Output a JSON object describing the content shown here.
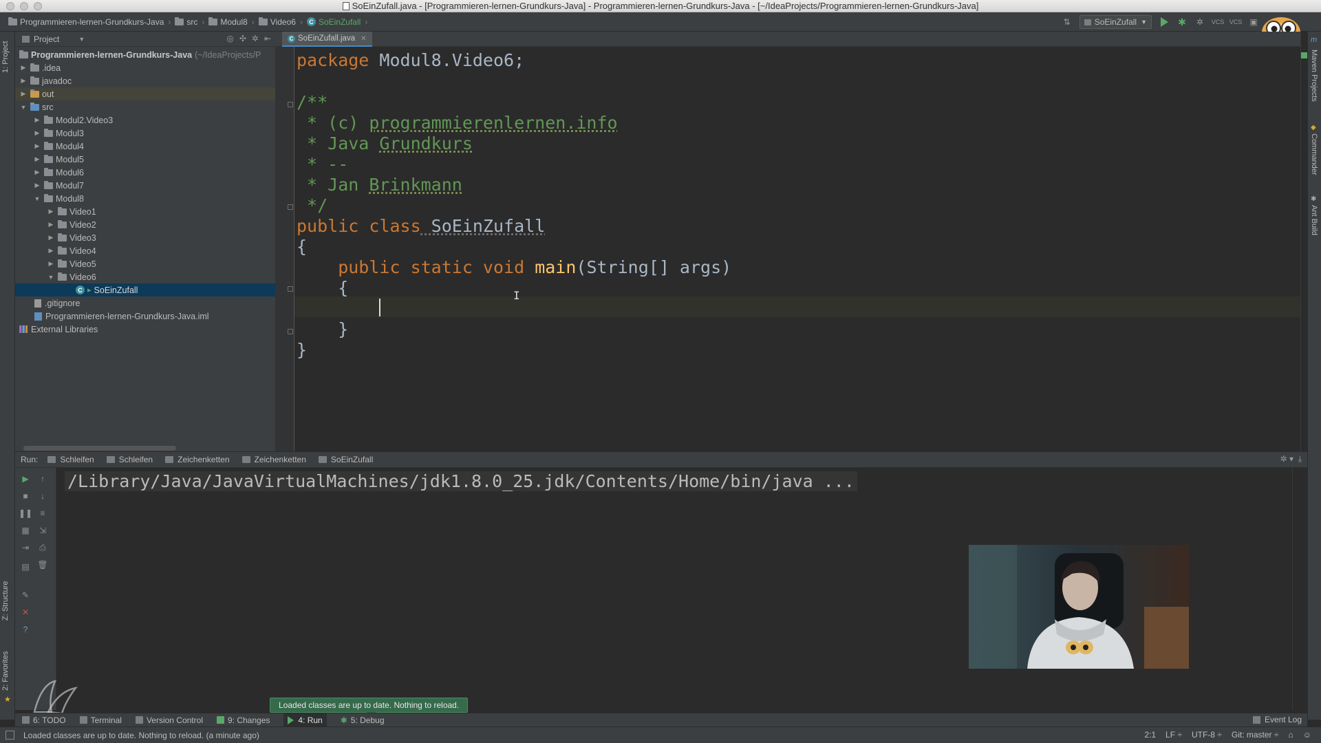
{
  "window": {
    "title": "SoEinZufall.java - [Programmieren-lernen-Grundkurs-Java] - Programmieren-lernen-Grundkurs-Java - [~/IdeaProjects/Programmieren-lernen-Grundkurs-Java]"
  },
  "navbar": {
    "crumbs": [
      "Programmieren-lernen-Grundkurs-Java",
      "src",
      "Modul8",
      "Video6",
      "SoEinZufall"
    ],
    "run_config": "SoEinZufall"
  },
  "left_strip": {
    "project_tab": "1: Project",
    "structure_tab": "Z: Structure",
    "favorites_tab": "2: Favorites"
  },
  "right_strip": {
    "maven_tab": "Maven Projects",
    "commander_tab": "Commander",
    "ant_tab": "Ant Build"
  },
  "project_panel": {
    "header": "Project",
    "root_name": "Programmieren-lernen-Grundkurs-Java",
    "root_path": "(~/IdeaProjects/P",
    "items": [
      ".idea",
      "javadoc",
      "out",
      "src",
      "Modul2.Video3",
      "Modul3",
      "Modul4",
      "Modul5",
      "Modul6",
      "Modul7",
      "Modul8",
      "Video1",
      "Video2",
      "Video3",
      "Video4",
      "Video5",
      "Video6",
      "SoEinZufall",
      ".gitignore",
      "Programmieren-lernen-Grundkurs-Java.iml",
      "External Libraries"
    ]
  },
  "editor": {
    "tab": "SoEinZufall.java",
    "code": {
      "l1_kw": "package",
      "l1_rest": " Modul8.Video6;",
      "l3": "/**",
      "l4_a": " * (c) ",
      "l4_b": "programmierenlernen.info",
      "l5_a": " * Java ",
      "l5_b": "Grundkurs",
      "l6": " * --",
      "l7_a": " * Jan ",
      "l7_b": "Brinkmann",
      "l8": " */",
      "l9_kw": "public class",
      "l9_rest": " SoEinZufall",
      "l10": "{",
      "l11_kw": "    public static void",
      "l11_fn": "main",
      "l11_rest": "(String[] args)",
      "l12": "    {",
      "l14": "    }",
      "l15": "}"
    }
  },
  "run_window": {
    "label": "Run:",
    "tabs": [
      "Schleifen",
      "Schleifen",
      "Zeichenketten",
      "Zeichenketten",
      "SoEinZufall"
    ],
    "command": "/Library/Java/JavaVirtualMachines/jdk1.8.0_25.jdk/Contents/Home/bin/java ..."
  },
  "balloon": "Loaded classes are up to date. Nothing to reload.",
  "bottom_tabs": {
    "todo": "6: TODO",
    "terminal": "Terminal",
    "vcs": "Version Control",
    "changes": "9: Changes",
    "run": "4: Run",
    "debug": "5: Debug",
    "event_log": "Event Log"
  },
  "statusbar": {
    "message": "Loaded classes are up to date. Nothing to reload. (a minute ago)",
    "position": "2:1",
    "line_sep": "LF ÷",
    "encoding": "UTF-8 ÷",
    "git": "Git: master ÷"
  }
}
